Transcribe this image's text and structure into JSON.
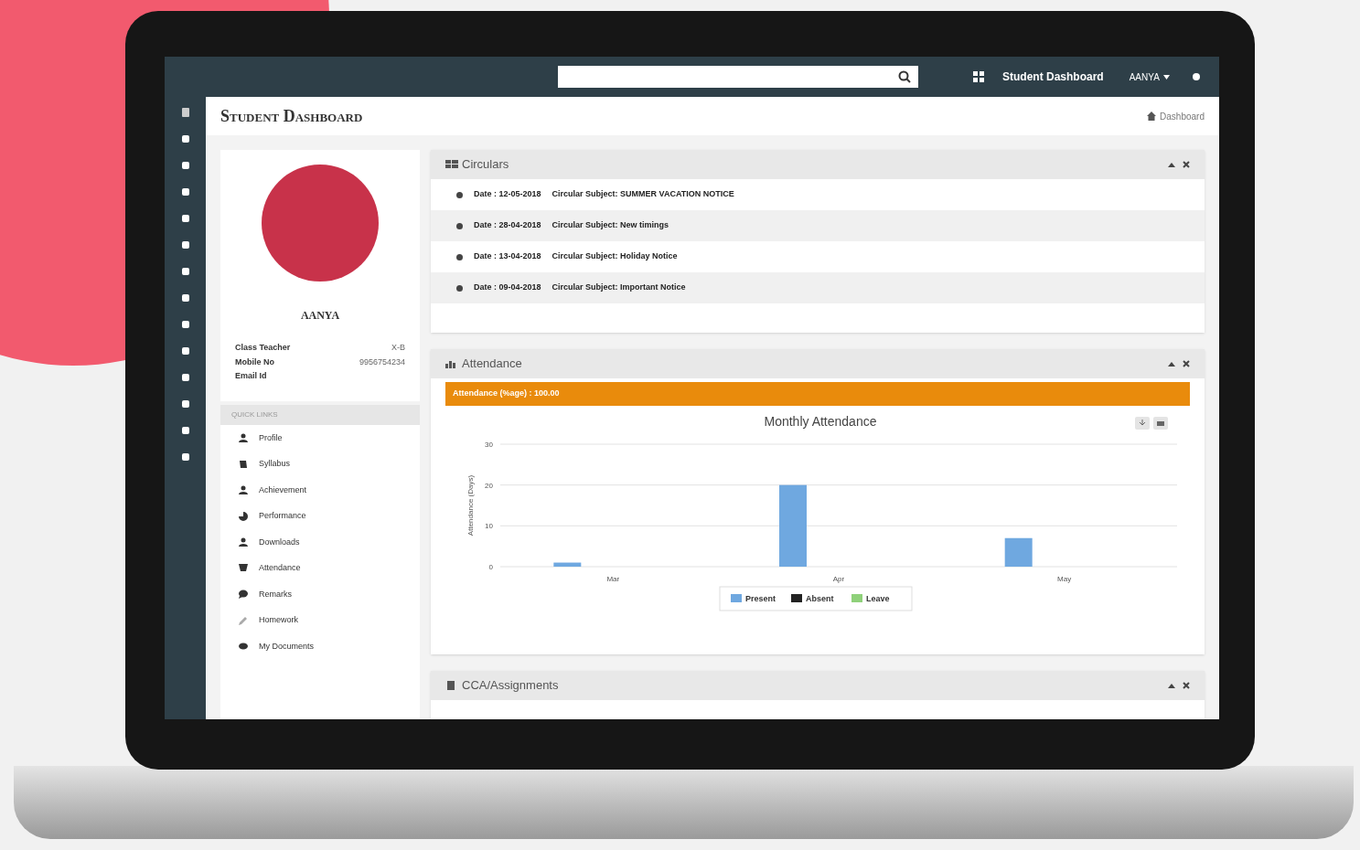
{
  "topbar": {
    "title": "Student Dashboard",
    "user": "AANYA"
  },
  "page": {
    "title": "Student Dashboard",
    "breadcrumb": "Dashboard"
  },
  "profile": {
    "name": "AANYA",
    "fields": [
      {
        "label": "Class Teacher",
        "value": "X-B"
      },
      {
        "label": "Mobile No",
        "value": "9956754234"
      },
      {
        "label": "Email Id"
      }
    ]
  },
  "quick_links": {
    "title": "QUICK LINKS",
    "items": [
      {
        "label": "Profile",
        "kind": "person"
      },
      {
        "label": "Syllabus",
        "kind": "book"
      },
      {
        "label": "Achievement",
        "kind": "person"
      },
      {
        "label": "Performance",
        "kind": "chart"
      },
      {
        "label": "Downloads",
        "kind": "person"
      },
      {
        "label": "Attendance",
        "kind": "cup"
      },
      {
        "label": "Remarks",
        "kind": "comment"
      },
      {
        "label": "Homework",
        "kind": "edit"
      },
      {
        "label": "My Documents",
        "kind": "eye"
      }
    ]
  },
  "circulars": {
    "title": "Circulars",
    "items": [
      {
        "date": "Date : 12-05-2018",
        "subject": "Circular Subject: SUMMER VACATION NOTICE"
      },
      {
        "date": "Date : 28-04-2018",
        "subject": "Circular Subject: New timings"
      },
      {
        "date": "Date : 13-04-2018",
        "subject": "Circular Subject: Holiday Notice"
      },
      {
        "date": "Date : 09-04-2018",
        "subject": "Circular Subject: Important Notice"
      }
    ]
  },
  "attendance": {
    "title": "Attendance",
    "banner": "Attendance (%age) : 100.00",
    "chart_data": {
      "type": "bar",
      "title": "Monthly Attendance",
      "ylabel": "Attendance (Days)",
      "categories": [
        "Mar",
        "Apr",
        "May"
      ],
      "series": [
        {
          "name": "Present",
          "color": "#6fa8e0",
          "values": [
            1,
            20,
            7
          ]
        },
        {
          "name": "Absent",
          "color": "#222222",
          "values": [
            null,
            null,
            null
          ]
        },
        {
          "name": "Leave",
          "color": "#8fd17a",
          "values": [
            null,
            null,
            null
          ]
        }
      ],
      "ylim": [
        0,
        30
      ],
      "yticks": [
        0,
        10,
        20,
        30
      ]
    }
  },
  "cca": {
    "title": "CCA/Assignments"
  }
}
